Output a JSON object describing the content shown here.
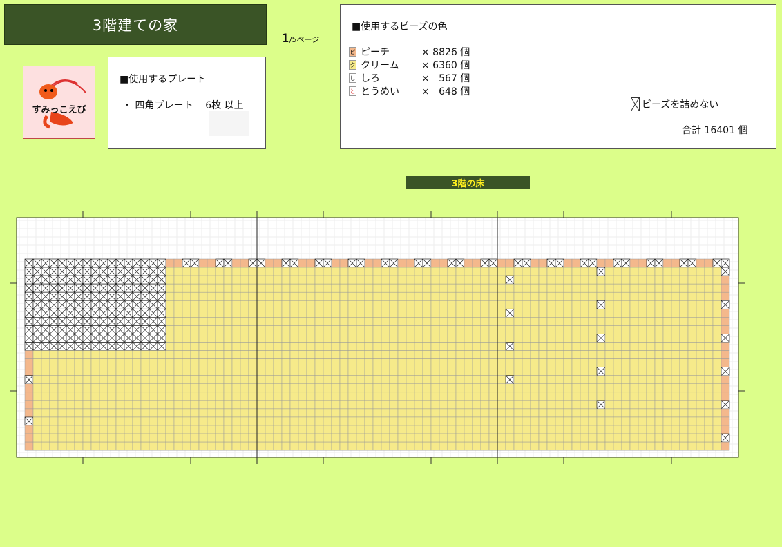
{
  "title": "3階建ての家",
  "page_indicator": {
    "current": "1",
    "rest": "/5ページ"
  },
  "logo": {
    "caption": "すみっこえび",
    "icon": "shrimp-icon"
  },
  "plate_box": {
    "heading": "■使用するプレート",
    "bullet": "・",
    "item": "四角プレート",
    "qty": "6枚 以上"
  },
  "colors_box": {
    "heading": "■使用するビーズの色",
    "rows": [
      {
        "symbol": "ピ",
        "name": "ピーチ",
        "count": "× 8826 個",
        "color": "#f4b88c"
      },
      {
        "symbol": "ク",
        "name": "クリーム",
        "count": "× 6360 個",
        "color": "#f6ea8a"
      },
      {
        "symbol": "し",
        "name": "しろ",
        "count": "×   567 個",
        "color": "#ffffff"
      },
      {
        "symbol": "と",
        "name": "とうめい",
        "count": "×   648 個",
        "color": "#ffffff"
      }
    ],
    "no_fill_label": "ビーズを詰めない",
    "total": "合計  16401 個"
  },
  "section_label": "3階の床",
  "pattern": {
    "cols": 85,
    "rows": 23,
    "colors": {
      "peach": "#f4b88c",
      "cream": "#f6ea8a",
      "empty": "#ffffff",
      "outer": "#ffffff"
    }
  }
}
